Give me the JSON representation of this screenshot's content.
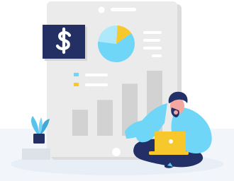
{
  "illustration": {
    "icon_names": [
      "dollar-icon",
      "pie-chart-icon",
      "bar-chart-icon",
      "plant-icon",
      "laptop-icon",
      "person-figure"
    ],
    "pie_chart": {
      "segments": [
        {
          "share": 0.62
        },
        {
          "share": 0.24
        },
        {
          "share": 0.14
        }
      ]
    },
    "bar_chart": {
      "levels": [
        0.4,
        0.55,
        0.8,
        1.0
      ]
    },
    "colors": {
      "background": "#ffffff",
      "floor": "#eef3f8",
      "document": "#e9e9e9",
      "document_shadow": "#dedede",
      "lines": "#f6f6f6",
      "navy": "#243063",
      "sky": "#6fd6f7",
      "sky_light": "#aee9fb",
      "yellow": "#f7c82b",
      "bar_gray": "#d2d2d2",
      "skin": "#f4a79f",
      "pants": "#223067",
      "plant_leaf": "#56c4ee",
      "plant_pot": "#243063"
    }
  }
}
